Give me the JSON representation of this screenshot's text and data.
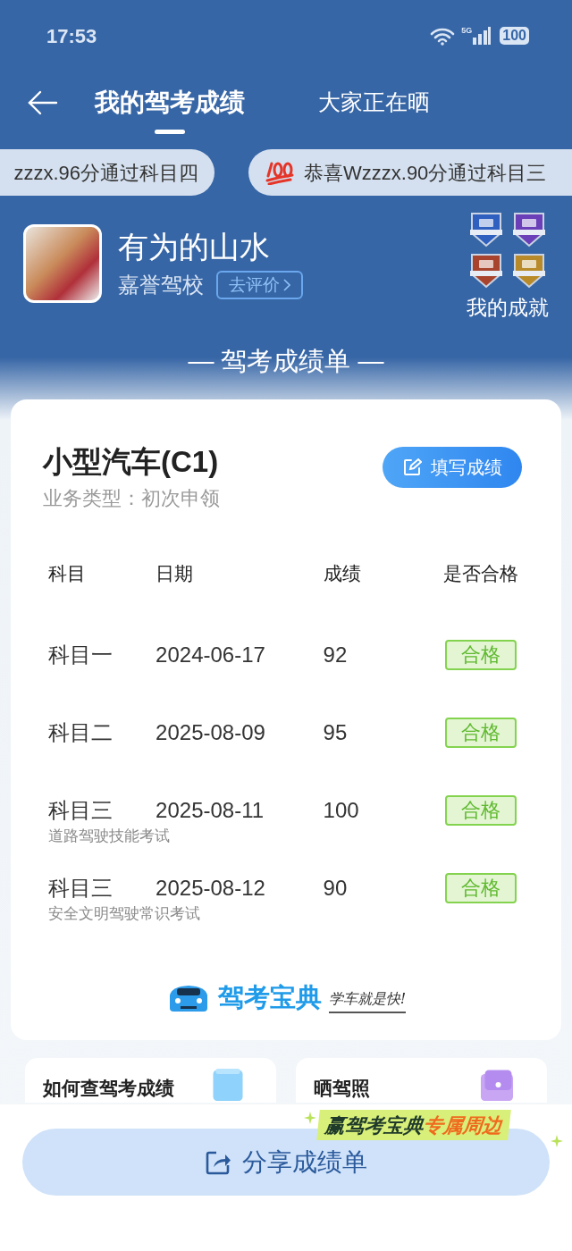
{
  "status_bar": {
    "time": "17:53",
    "network": "5G",
    "battery": "100"
  },
  "tabs": [
    {
      "label": "我的驾考成绩",
      "selected": true
    },
    {
      "label": "大家正在晒",
      "selected": false
    }
  ],
  "ticker": [
    {
      "text": "zzzx.96分通过科目四",
      "kind": "plain"
    },
    {
      "text": "恭喜Wzzzx.90分通过科目三",
      "kind": "hundred"
    }
  ],
  "profile": {
    "name": "有为的山水",
    "school": "嘉誉驾校",
    "review_link": "去评价",
    "achievements_label": "我的成就"
  },
  "section_title": "— 驾考成绩单 —",
  "card": {
    "title": "小型汽车(C1)",
    "business_type": "业务类型：初次申领",
    "fill_button": "填写成绩",
    "columns": [
      "科目",
      "日期",
      "成绩",
      "是否合格"
    ],
    "rows": [
      {
        "subject": "科目一",
        "date": "2024-06-17",
        "score": "92",
        "result": "合格"
      },
      {
        "subject": "科目二",
        "date": "2025-08-09",
        "score": "95",
        "result": "合格"
      },
      {
        "subject": "科目三",
        "date": "2025-08-11",
        "score": "100",
        "result": "合格",
        "note": "道路驾驶技能考试"
      },
      {
        "subject": "科目三",
        "date": "2025-08-12",
        "score": "90",
        "result": "合格",
        "note": "安全文明驾驶常识考试"
      }
    ],
    "brand": "驾考宝典",
    "slogan": "学车就是快!"
  },
  "tiles": [
    {
      "title": "如何查驾考成绩",
      "kind": "query"
    },
    {
      "title": "晒驾照",
      "kind": "license"
    }
  ],
  "promo": {
    "text": "赢驾考宝典",
    "highlight": "专属周边"
  },
  "share_button": "分享成绩单"
}
